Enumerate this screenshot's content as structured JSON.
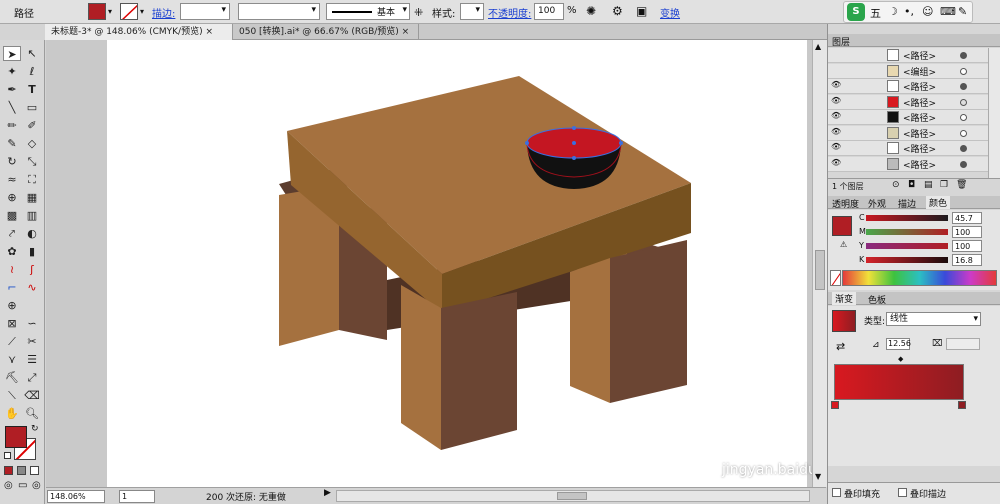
{
  "control_bar": {
    "object_type": "路径",
    "stroke_label": "描边:",
    "stroke_style": "基本",
    "style_label": "样式:",
    "opacity_label": "不透明度:",
    "opacity_value": "100",
    "opacity_unit": "%",
    "transform_label": "变换"
  },
  "doc_tabs": [
    {
      "label": "未标题-3* @ 148.06% (CMYK/预览)",
      "close": "×"
    },
    {
      "label": "050 [转换].ai* @ 66.67% (RGB/预览)",
      "close": "×"
    }
  ],
  "status_bar": {
    "zoom": "148.06%",
    "page": "1",
    "history": "200 次还原: 无重做"
  },
  "layers_panel": {
    "title": "图层",
    "rows": [
      {
        "name": "<路径>"
      },
      {
        "name": "<编组>"
      },
      {
        "name": "<路径>"
      },
      {
        "name": "<路径>"
      },
      {
        "name": "<路径>"
      },
      {
        "name": "<路径>"
      },
      {
        "name": "<路径>"
      },
      {
        "name": "<路径>"
      }
    ],
    "footer": "1 个图层"
  },
  "color_panel": {
    "tabs": [
      "透明度",
      "外观",
      "描边",
      "颜色"
    ],
    "channels": [
      {
        "label": "C",
        "value": "45.7"
      },
      {
        "label": "M",
        "value": "100"
      },
      {
        "label": "Y",
        "value": "100"
      },
      {
        "label": "K",
        "value": "16.8"
      }
    ]
  },
  "gradient_panel": {
    "tabs": [
      "渐变",
      "色板"
    ],
    "type_label": "类型:",
    "type_value": "线性",
    "angle": "12.56"
  },
  "bottom_panel": {
    "fill_label": "叠印填充",
    "stroke_label": "叠印描边"
  },
  "watermark": "jingyan.baidu.com",
  "colors": {
    "fill": "#b01e24",
    "gradient_start": "#d81920",
    "gradient_end": "#8e1d22",
    "selection": "#3b6fe0"
  }
}
